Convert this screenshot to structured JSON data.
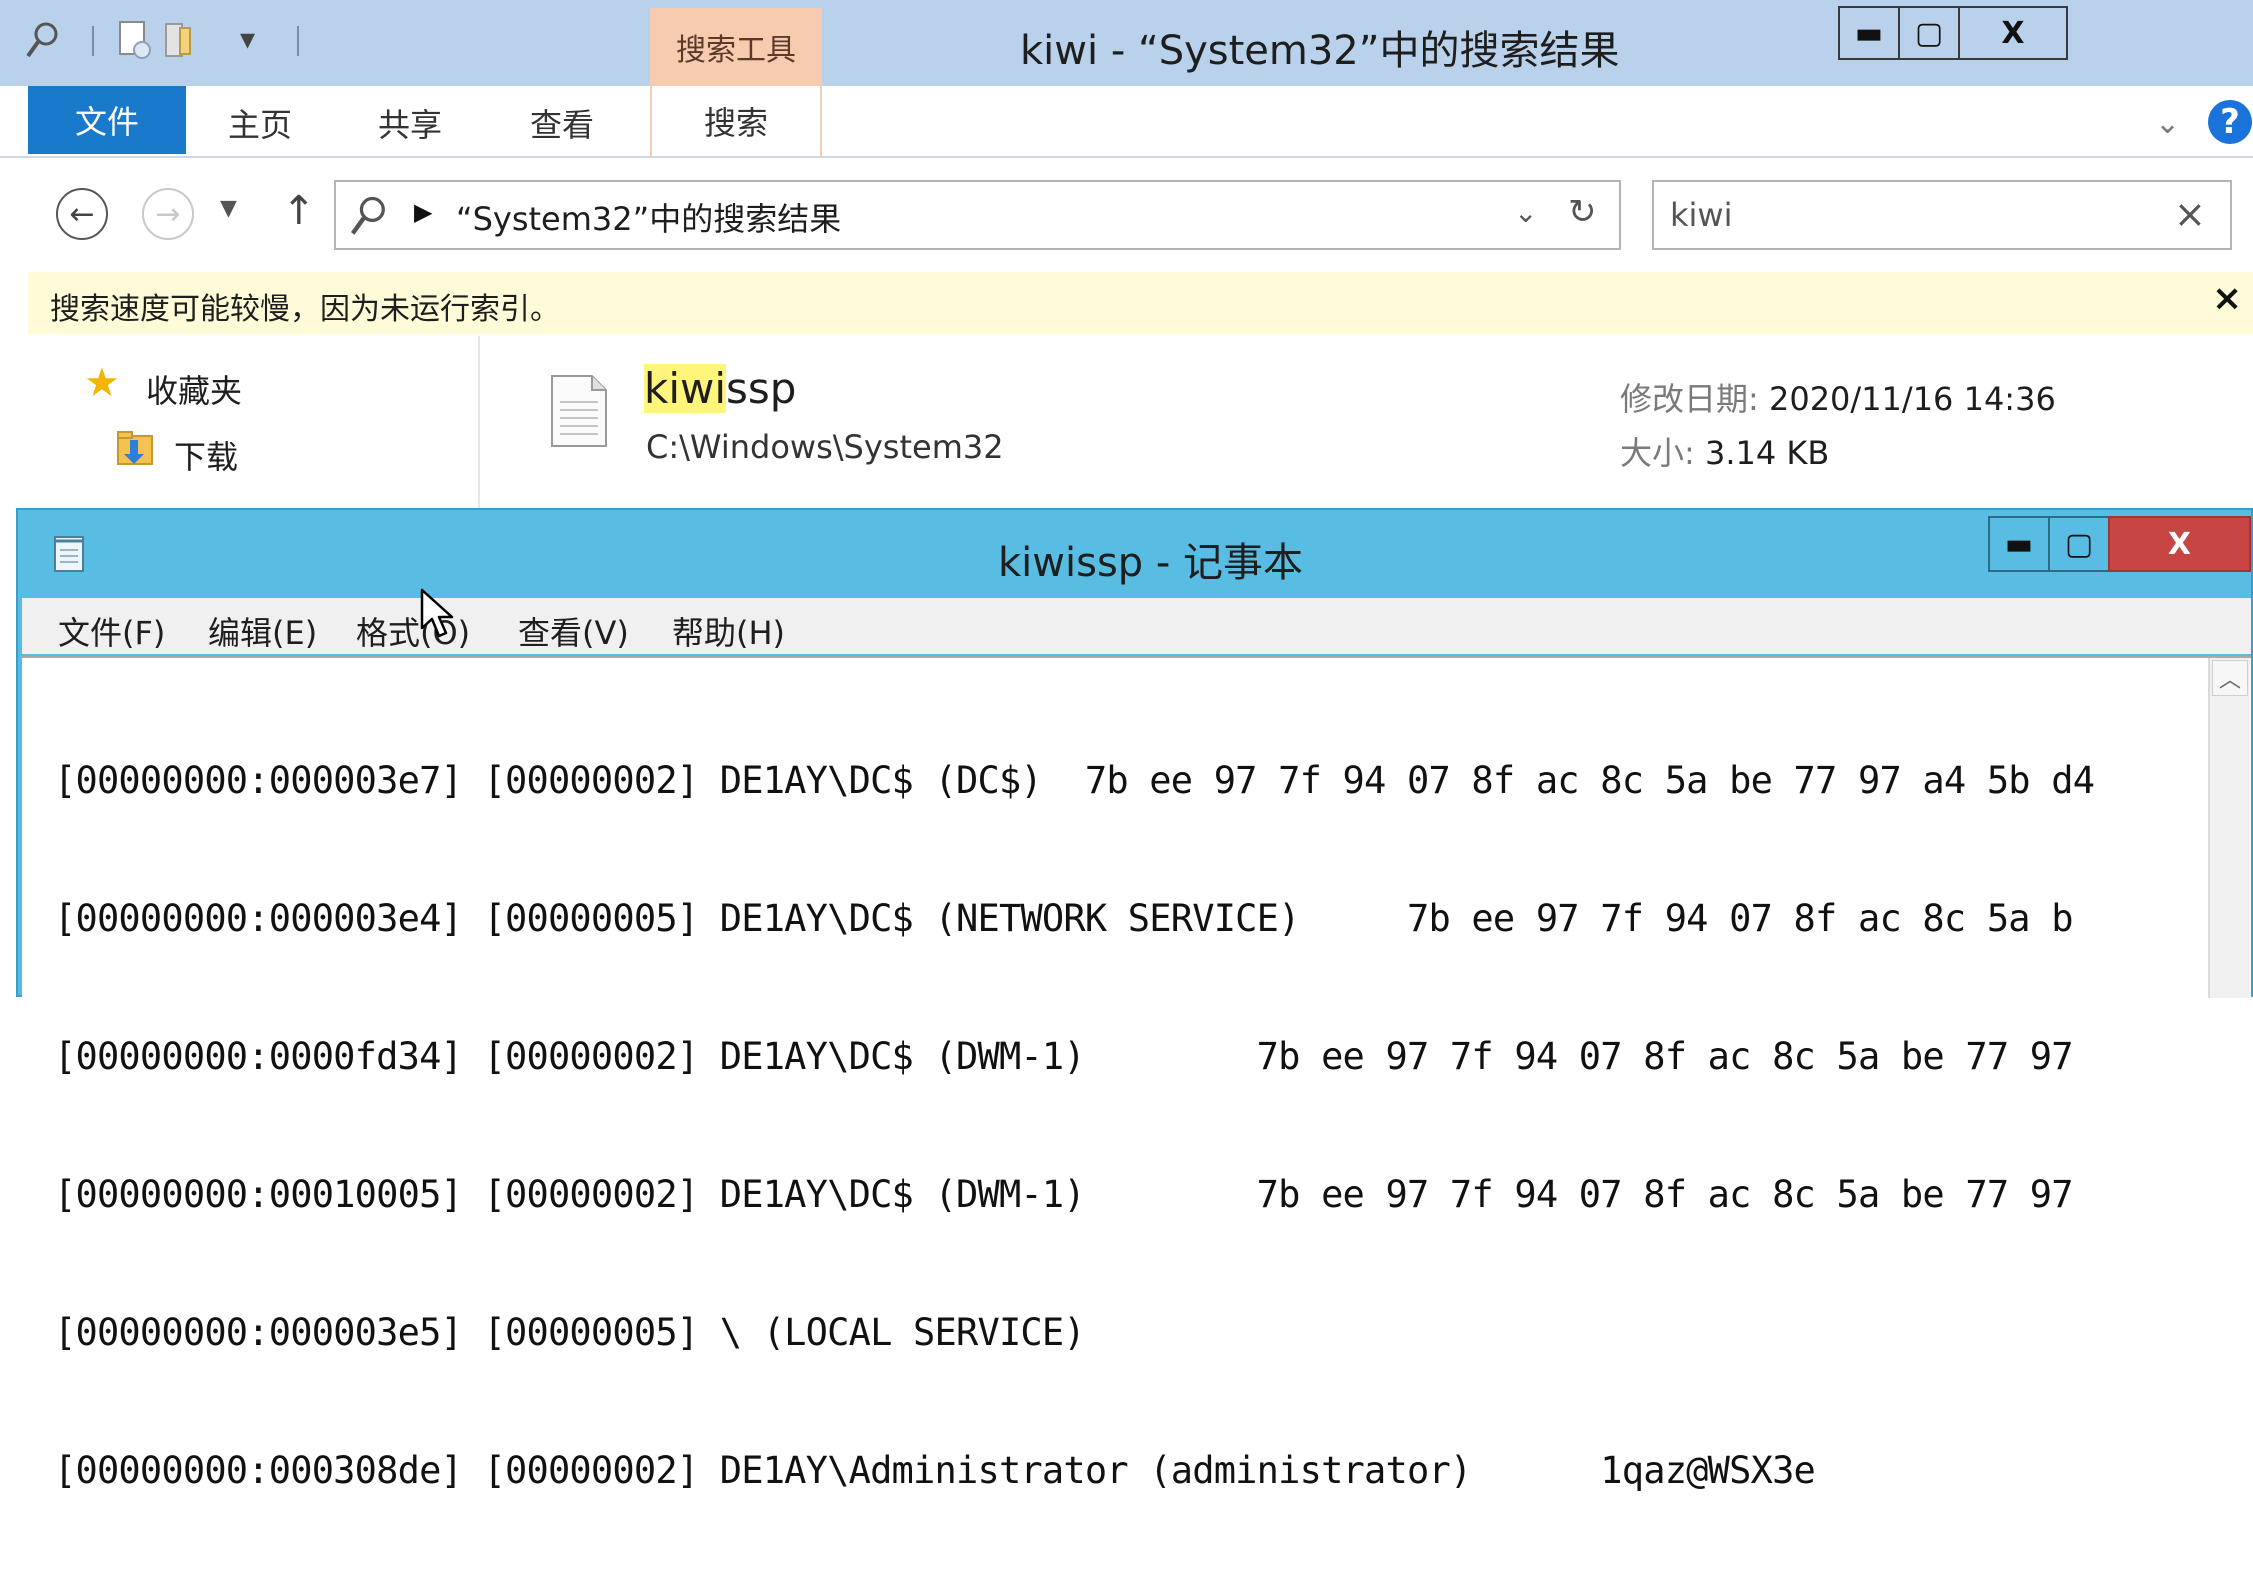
{
  "explorer": {
    "title": "kiwi - “System32”中的搜索结果",
    "search_tools_tab": "搜索工具",
    "ribbon_tabs": {
      "file": "文件",
      "home": "主页",
      "share": "共享",
      "view": "查看",
      "search": "搜索"
    },
    "window_controls": {
      "minimize": "▬",
      "maximize": "▢",
      "close": "X"
    },
    "address": "“System32”中的搜索结果",
    "search_value": "kiwi",
    "info_bar": "搜索速度可能较慢，因为未运行索引。",
    "nav": {
      "favorites": "收藏夹",
      "downloads": "下载"
    },
    "result": {
      "name_match": "kiwi",
      "name_rest": "ssp",
      "path": "C:\\Windows\\System32",
      "modified_label": "修改日期: ",
      "modified_value": "2020/11/16 14:36",
      "size_label": "大小: ",
      "size_value": "3.14 KB"
    }
  },
  "notepad": {
    "title": "kiwissp - 记事本",
    "menu": {
      "file": "文件(F)",
      "edit": "编辑(E)",
      "format": "格式(O)",
      "view": "查看(V)",
      "help": "帮助(H)"
    },
    "lines": [
      "[00000000:000003e7] [00000002] DE1AY\\DC$ (DC$)  7b ee 97 7f 94 07 8f ac 8c 5a be 77 97 a4 5b d4",
      "[00000000:000003e4] [00000005] DE1AY\\DC$ (NETWORK SERVICE)     7b ee 97 7f 94 07 8f ac 8c 5a b",
      "[00000000:0000fd34] [00000002] DE1AY\\DC$ (DWM-1)        7b ee 97 7f 94 07 8f ac 8c 5a be 77 97",
      "[00000000:00010005] [00000002] DE1AY\\DC$ (DWM-1)        7b ee 97 7f 94 07 8f ac 8c 5a be 77 97",
      "[00000000:000003e5] [00000005] \\ (LOCAL SERVICE)",
      "[00000000:000308de] [00000002] DE1AY\\Administrator (administrator)      1qaz@WSX3e"
    ]
  },
  "colors": {
    "explorer_titlebar": "#b9d1ea",
    "file_tab": "#1979ca",
    "search_tools": "#f7cbb0",
    "info_bar": "#fffbd8",
    "notepad_titlebar": "#58bce3",
    "close_red": "#c74643",
    "highlight": "#fff57a"
  }
}
